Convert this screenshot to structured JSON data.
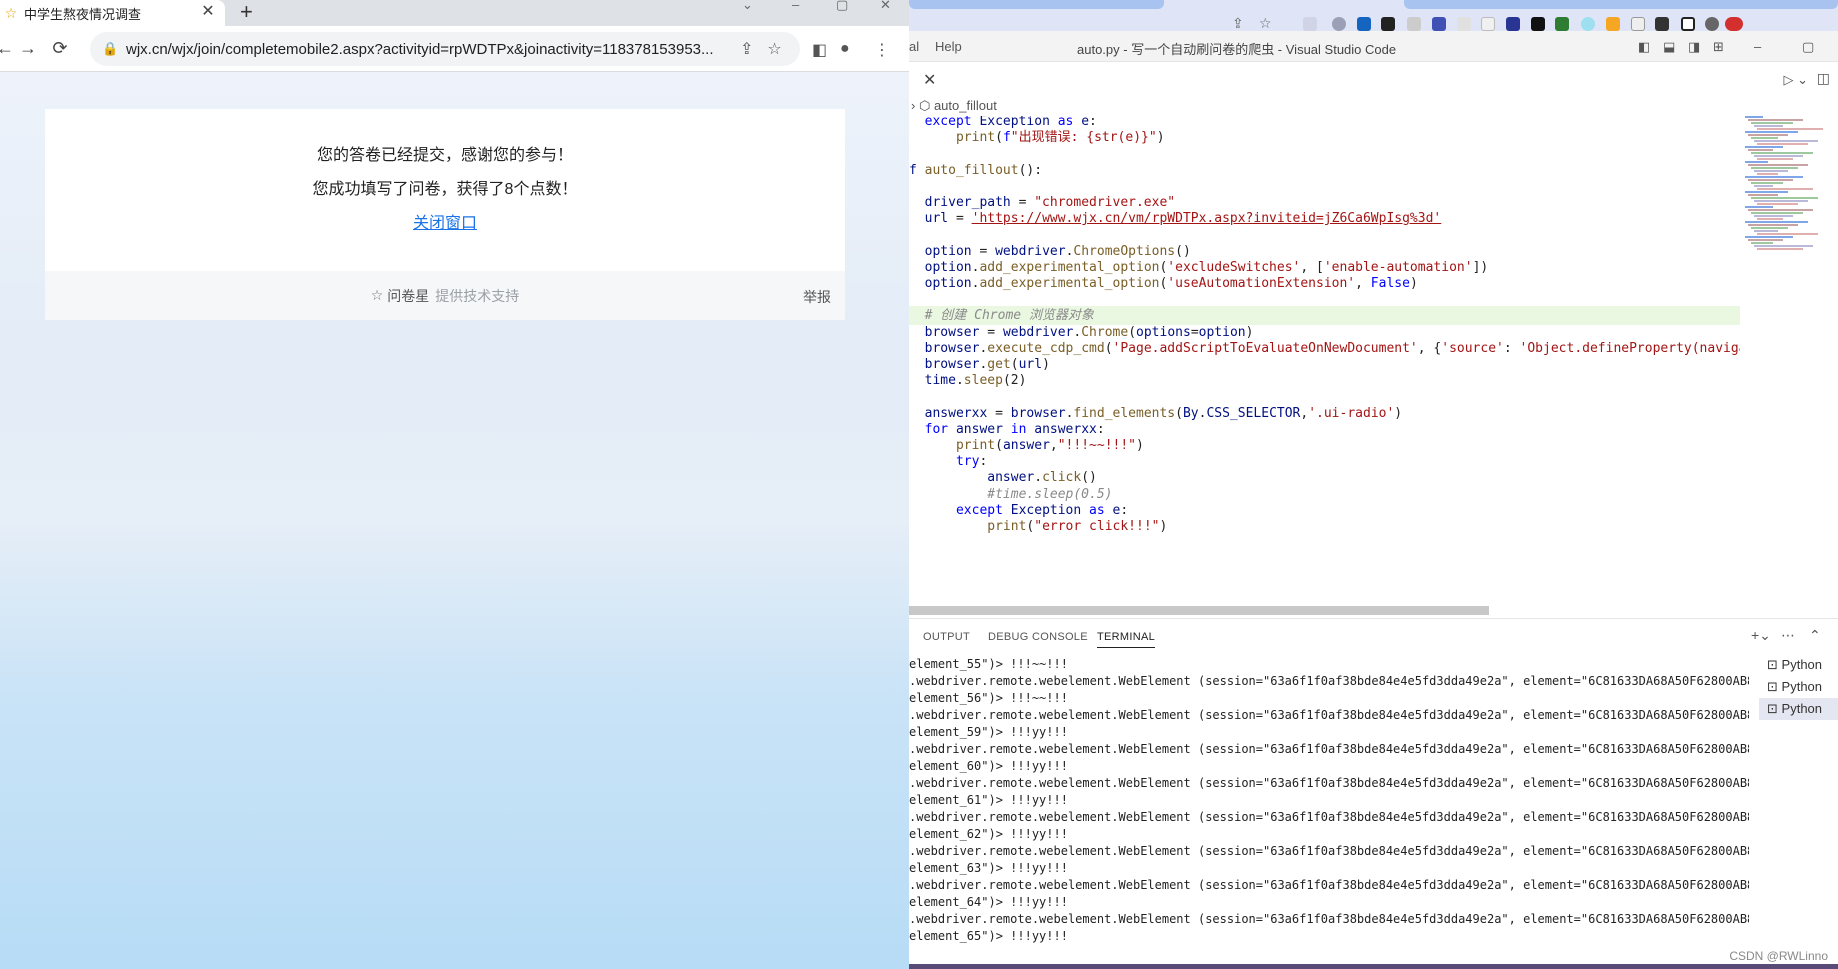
{
  "browser": {
    "tab_title": "中学生熬夜情况调查",
    "url": "wjx.cn/wjx/join/completemobile2.aspx?activityid=rpWDTPx&joinactivity=118378153953..."
  },
  "survey": {
    "message_submitted": "您的答卷已经提交，感谢您的参与！",
    "message_points": "您成功填写了问卷，获得了8个点数！",
    "close_link": "关闭窗口",
    "footer_brand": "问卷星",
    "footer_tech": "提供技术支持",
    "footer_report": "举报"
  },
  "vscode": {
    "menu_partial": "al",
    "menu_help": "Help",
    "window_title": "auto.py - 写一个自动刷问卷的爬虫 - Visual Studio Code",
    "breadcrumb": "auto_fillout",
    "code_lines": [
      "  except Exception as e:",
      "      print(f\"出现错误: {str(e)}\")",
      "",
      "f auto_fillout():",
      "",
      "  driver_path = \"chromedriver.exe\"",
      "  url = 'https://www.wjx.cn/vm/rpWDTPx.aspx?inviteid=jZ6Ca6WpIsg%3d'",
      "",
      "  option = webdriver.ChromeOptions()",
      "  option.add_experimental_option('excludeSwitches', ['enable-automation'])",
      "  option.add_experimental_option('useAutomationExtension', False)",
      "",
      "  # 创建 Chrome 浏览器对象",
      "  browser = webdriver.Chrome(options=option)",
      "  browser.execute_cdp_cmd('Page.addScriptToEvaluateOnNewDocument', {'source': 'Object.defineProperty(navigato",
      "  browser.get(url)",
      "  time.sleep(2)",
      "",
      "  answerxx = browser.find_elements(By.CSS_SELECTOR,'.ui-radio')",
      "  for answer in answerxx:",
      "      print(answer,\"!!!~~!!!\")",
      "      try:",
      "          answer.click()",
      "          #time.sleep(0.5)",
      "      except Exception as e:",
      "          print(\"error click!!!\")"
    ],
    "panel_tabs": [
      "OUTPUT",
      "DEBUG CONSOLE",
      "TERMINAL"
    ],
    "terminal_lines": [
      "element_55\")> !!!~~!!!",
      ".webdriver.remote.webelement.WebElement (session=\"63a6f1f0af38bde84e4e5fd3dda49e2a\", element=\"6C81633DA68A50F62800AB8B",
      "element_56\")> !!!~~!!!",
      ".webdriver.remote.webelement.WebElement (session=\"63a6f1f0af38bde84e4e5fd3dda49e2a\", element=\"6C81633DA68A50F62800AB8B",
      "element_59\")> !!!yy!!!",
      ".webdriver.remote.webelement.WebElement (session=\"63a6f1f0af38bde84e4e5fd3dda49e2a\", element=\"6C81633DA68A50F62800AB8B",
      "element_60\")> !!!yy!!!",
      ".webdriver.remote.webelement.WebElement (session=\"63a6f1f0af38bde84e4e5fd3dda49e2a\", element=\"6C81633DA68A50F62800AB8B",
      "element_61\")> !!!yy!!!",
      ".webdriver.remote.webelement.WebElement (session=\"63a6f1f0af38bde84e4e5fd3dda49e2a\", element=\"6C81633DA68A50F62800AB8B",
      "element_62\")> !!!yy!!!",
      ".webdriver.remote.webelement.WebElement (session=\"63a6f1f0af38bde84e4e5fd3dda49e2a\", element=\"6C81633DA68A50F62800AB8B",
      "element_63\")> !!!yy!!!",
      ".webdriver.remote.webelement.WebElement (session=\"63a6f1f0af38bde84e4e5fd3dda49e2a\", element=\"6C81633DA68A50F62800AB8B",
      "element_64\")> !!!yy!!!",
      ".webdriver.remote.webelement.WebElement (session=\"63a6f1f0af38bde84e4e5fd3dda49e2a\", element=\"6C81633DA68A50F62800AB8B",
      "element_65\")> !!!yy!!!"
    ],
    "terminals": [
      "Python",
      "Python",
      "Python"
    ],
    "watermark": "CSDN @RWLinno"
  },
  "colors": {
    "link": "#1a73e8",
    "vs_keyword": "#0000ff",
    "vs_string": "#a31515",
    "vs_function": "#795e26",
    "vs_highlight": "#eaf7e1"
  }
}
